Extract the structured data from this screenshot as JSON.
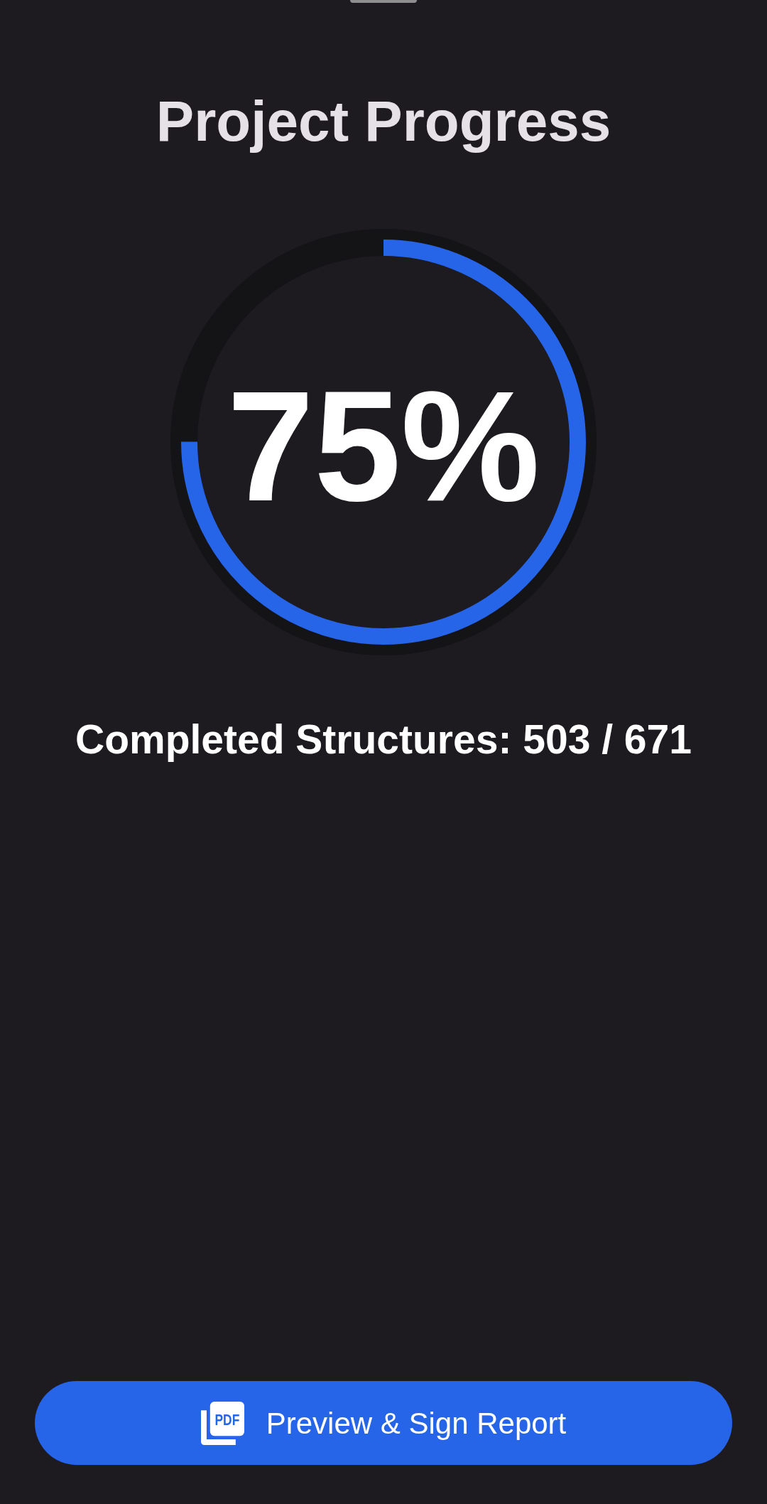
{
  "title": "Project Progress",
  "progress": {
    "level": 0.75,
    "percent": "75%",
    "summary": "Completed Structures: 503 / 671"
  },
  "action_button": {
    "icon_text": "PDF",
    "label": "Preview & Sign Report"
  }
}
